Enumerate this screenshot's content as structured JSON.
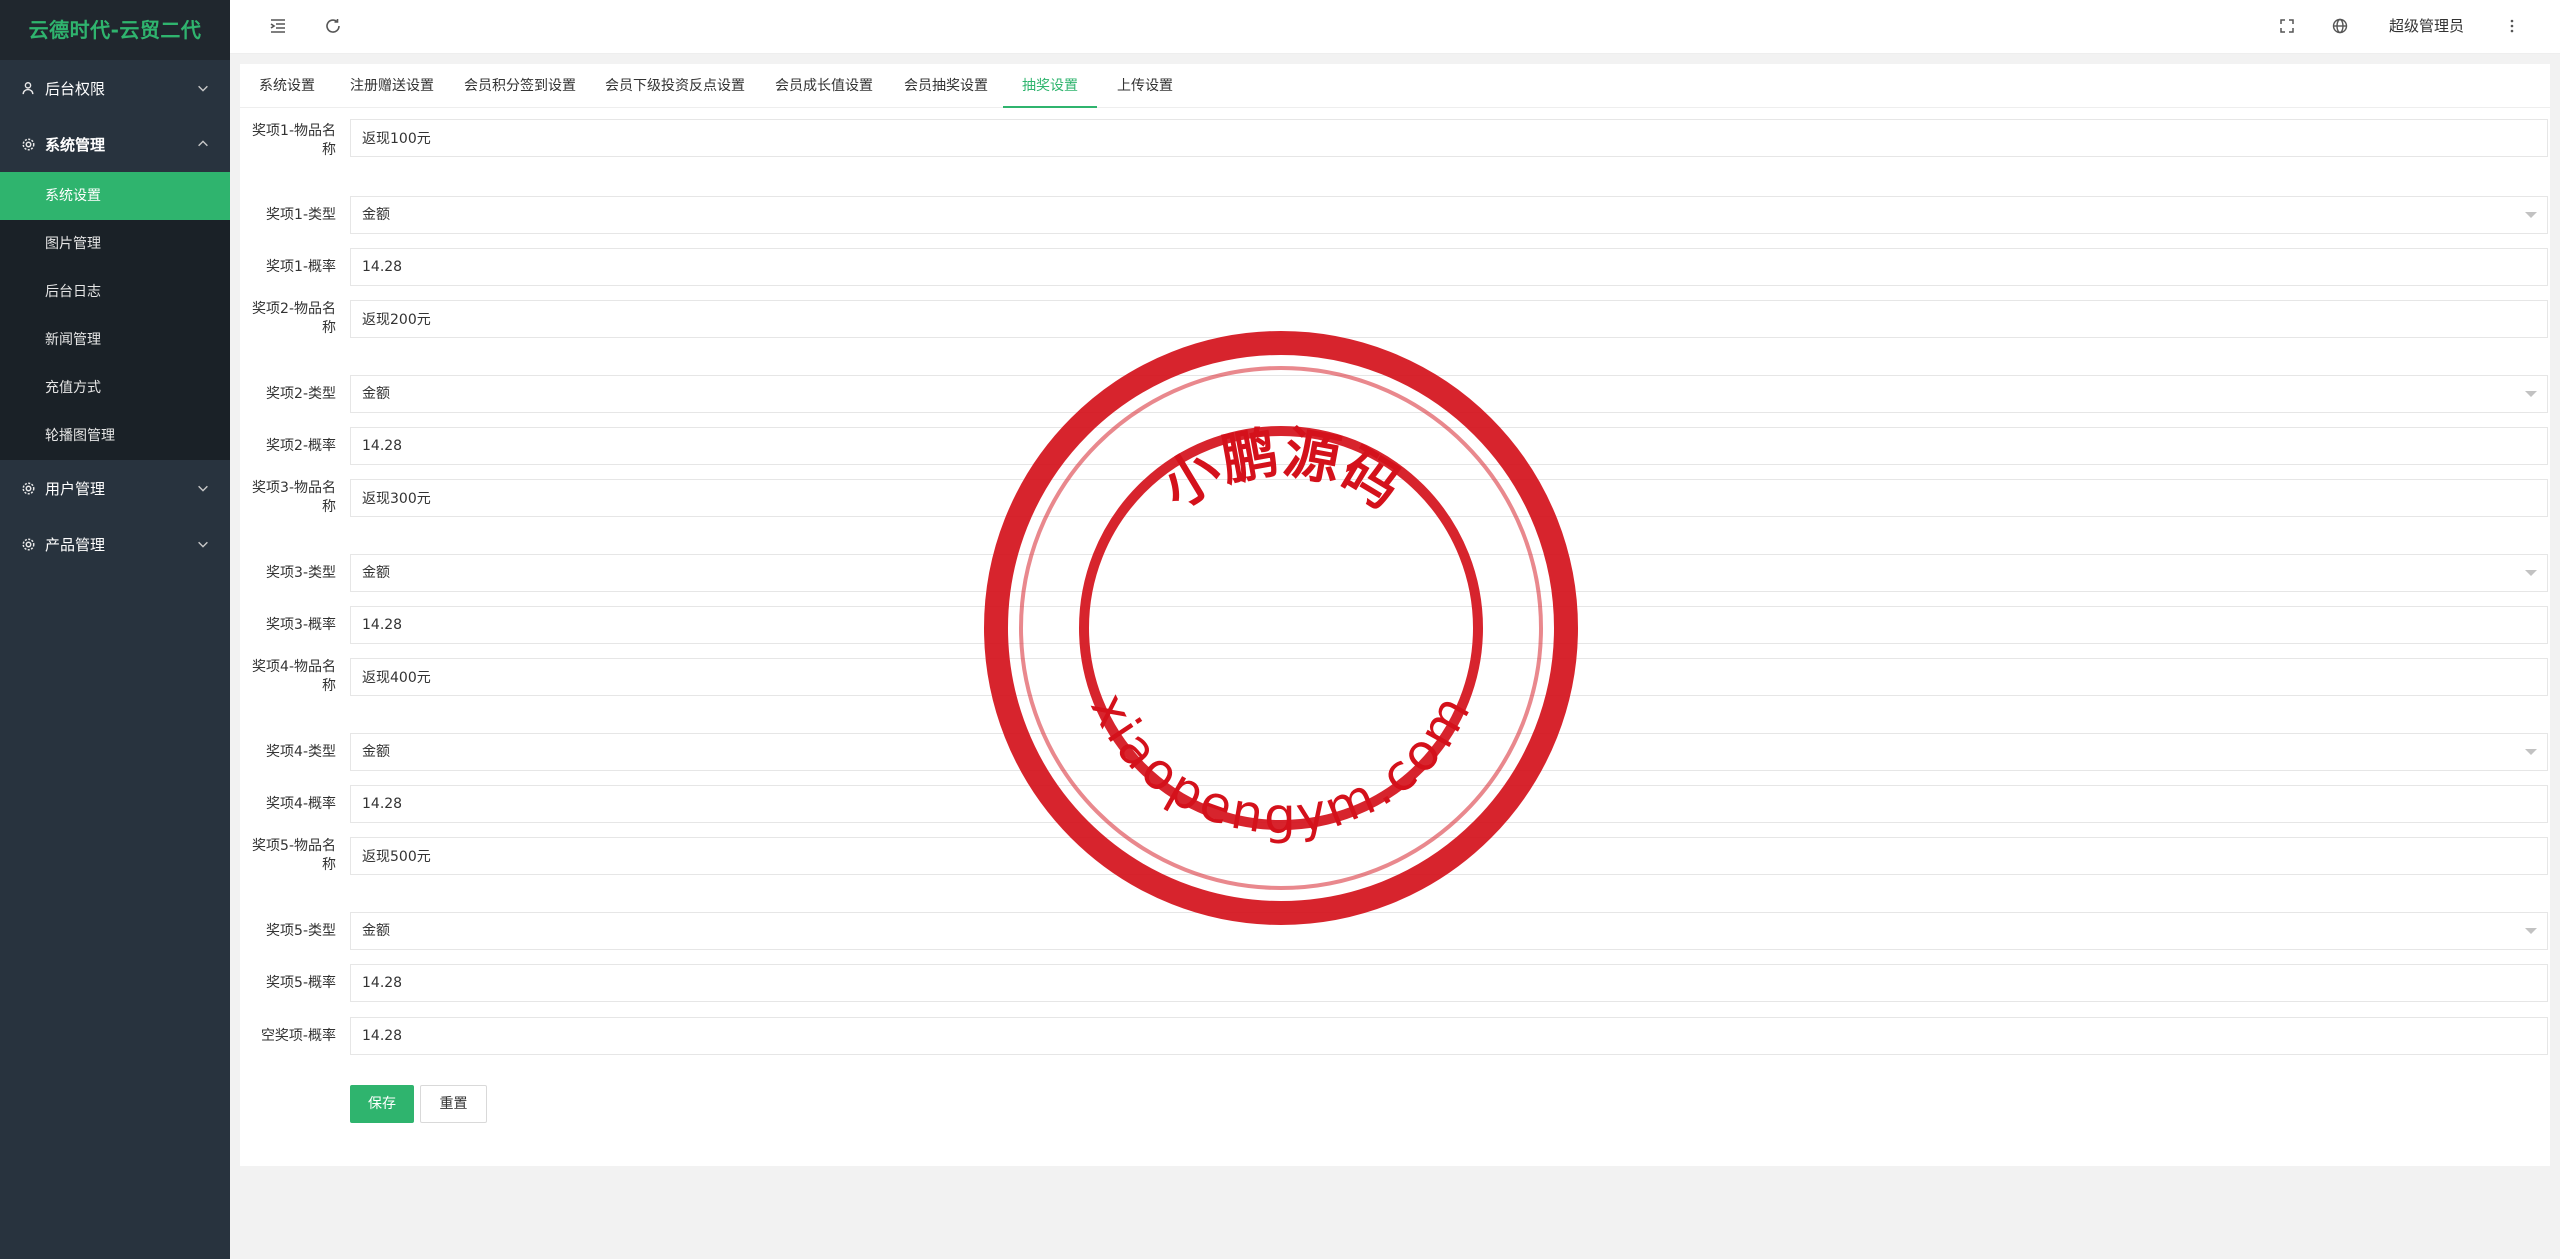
{
  "brand": "云德时代-云贸二代",
  "sidebar": {
    "groups": [
      {
        "label": "后台权限",
        "icon": "user-icon"
      },
      {
        "label": "系统管理",
        "icon": "gear-icon"
      },
      {
        "label": "用户管理",
        "icon": "gear-icon"
      },
      {
        "label": "产品管理",
        "icon": "gear-icon"
      }
    ],
    "system_items": [
      "系统设置",
      "图片管理",
      "后台日志",
      "新闻管理",
      "充值方式",
      "轮播图管理"
    ]
  },
  "header": {
    "admin_name": "超级管理员"
  },
  "tabs": [
    "系统设置",
    "注册赠送设置",
    "会员积分签到设置",
    "会员下级投资反点设置",
    "会员成长值设置",
    "会员抽奖设置",
    "抽奖设置",
    "上传设置"
  ],
  "active_tab": "抽奖设置",
  "form": {
    "rows": [
      {
        "label": "奖项1-物品名称",
        "value": "返现100元"
      },
      {
        "label": "奖项1-类型",
        "value": "金额"
      },
      {
        "label": "奖项1-概率",
        "value": "14.28"
      },
      {
        "label": "奖项2-物品名称",
        "value": "返现200元"
      },
      {
        "label": "奖项2-类型",
        "value": "金额"
      },
      {
        "label": "奖项2-概率",
        "value": "14.28"
      },
      {
        "label": "奖项3-物品名称",
        "value": "返现300元"
      },
      {
        "label": "奖项3-类型",
        "value": "金额"
      },
      {
        "label": "奖项3-概率",
        "value": "14.28"
      },
      {
        "label": "奖项4-物品名称",
        "value": "返现400元"
      },
      {
        "label": "奖项4-类型",
        "value": "金额"
      },
      {
        "label": "奖项4-概率",
        "value": "14.28"
      },
      {
        "label": "奖项5-物品名称",
        "value": "返现500元"
      },
      {
        "label": "奖项5-类型",
        "value": "金额"
      },
      {
        "label": "奖项5-概率",
        "value": "14.28"
      },
      {
        "label": "空奖项-概率",
        "value": "14.28"
      }
    ],
    "save_label": "保存",
    "reset_label": "重置"
  },
  "watermark": {
    "top_text": "小鹏源码",
    "bottom_text": "xiaopengym.com",
    "color": "#d4111b"
  },
  "colors": {
    "accent": "#2fb46e",
    "sidebar_bg": "#28333e"
  }
}
